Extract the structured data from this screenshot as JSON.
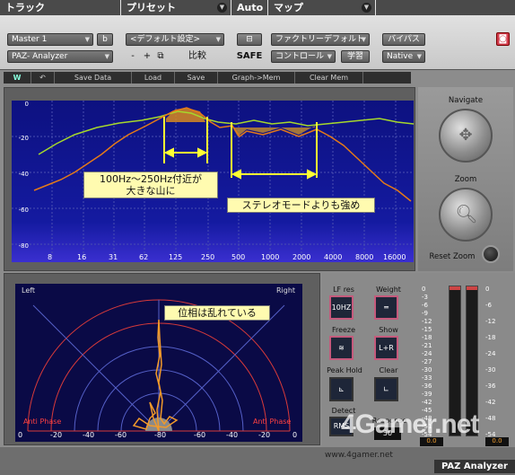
{
  "header": {
    "track_label": "トラック",
    "preset_label": "プリセット",
    "auto_label": "Auto",
    "map_label": "マップ",
    "track_name": "Master 1",
    "track_channel": "b",
    "plugin_name": "PAZ- Analyzer",
    "preset_name": "<デフォルト設定>",
    "minus": "-",
    "plus": "+",
    "compare": "比較",
    "safe": "SAFE",
    "map_name": "ファクトリーデフォルト",
    "control": "コントロール",
    "learn": "学習",
    "bypass": "バイパス",
    "native": "Native"
  },
  "toolbar": {
    "undo": "↶",
    "save_data": "Save Data",
    "load": "Load",
    "save": "Save",
    "graph_mem": "Graph->Mem",
    "clear_mem": "Clear Mem"
  },
  "spectrum": {
    "db_ticks": [
      "0",
      "-20",
      "-40",
      "-60",
      "-80"
    ],
    "freq_ticks": [
      "8",
      "16",
      "31",
      "62",
      "125",
      "250",
      "500",
      "1000",
      "2000",
      "4000",
      "8000",
      "16000"
    ]
  },
  "annotations": {
    "a1_line1": "100Hz～250Hz付近が",
    "a1_line2": "大きな山に",
    "a2": "ステレオモードよりも強め",
    "a3": "位相は乱れている"
  },
  "nav": {
    "navigate": "Navigate",
    "zoom": "Zoom",
    "reset_zoom": "Reset Zoom"
  },
  "phase": {
    "left": "Left",
    "right": "Right",
    "anti_l": "Anti Phase",
    "anti_r": "Anti Phase",
    "ticks": [
      "0",
      "-20",
      "-40",
      "-60",
      "-80",
      "-60",
      "-40",
      "-20",
      "0"
    ]
  },
  "controls": {
    "lf_res": "LF res",
    "lf_res_val": "10HZ",
    "weight": "Weight",
    "freeze": "Freeze",
    "show": "Show",
    "show_val": "L+R",
    "peak_hold": "Peak Hold",
    "clear": "Clear",
    "detect": "Detect",
    "detect_val": "RMS",
    "response": "Response",
    "response_val": "50"
  },
  "meters": {
    "scale": [
      "0",
      "-3",
      "-6",
      "-9",
      "-12",
      "-15",
      "-18",
      "-21",
      "-24",
      "-27",
      "-30",
      "-33",
      "-36",
      "-39",
      "-42",
      "-45",
      "-48",
      "-51",
      "-54"
    ],
    "readout": "0.0"
  },
  "footer": {
    "brand": "PAZ Analyzer",
    "watermark": "4Gamer.net",
    "url": "www.4gamer.net"
  },
  "colors": {
    "spec_bg": "#0b0e6a",
    "orange": "#e07a1a",
    "green": "#9ccf2f",
    "accent": "#d64a6a"
  }
}
